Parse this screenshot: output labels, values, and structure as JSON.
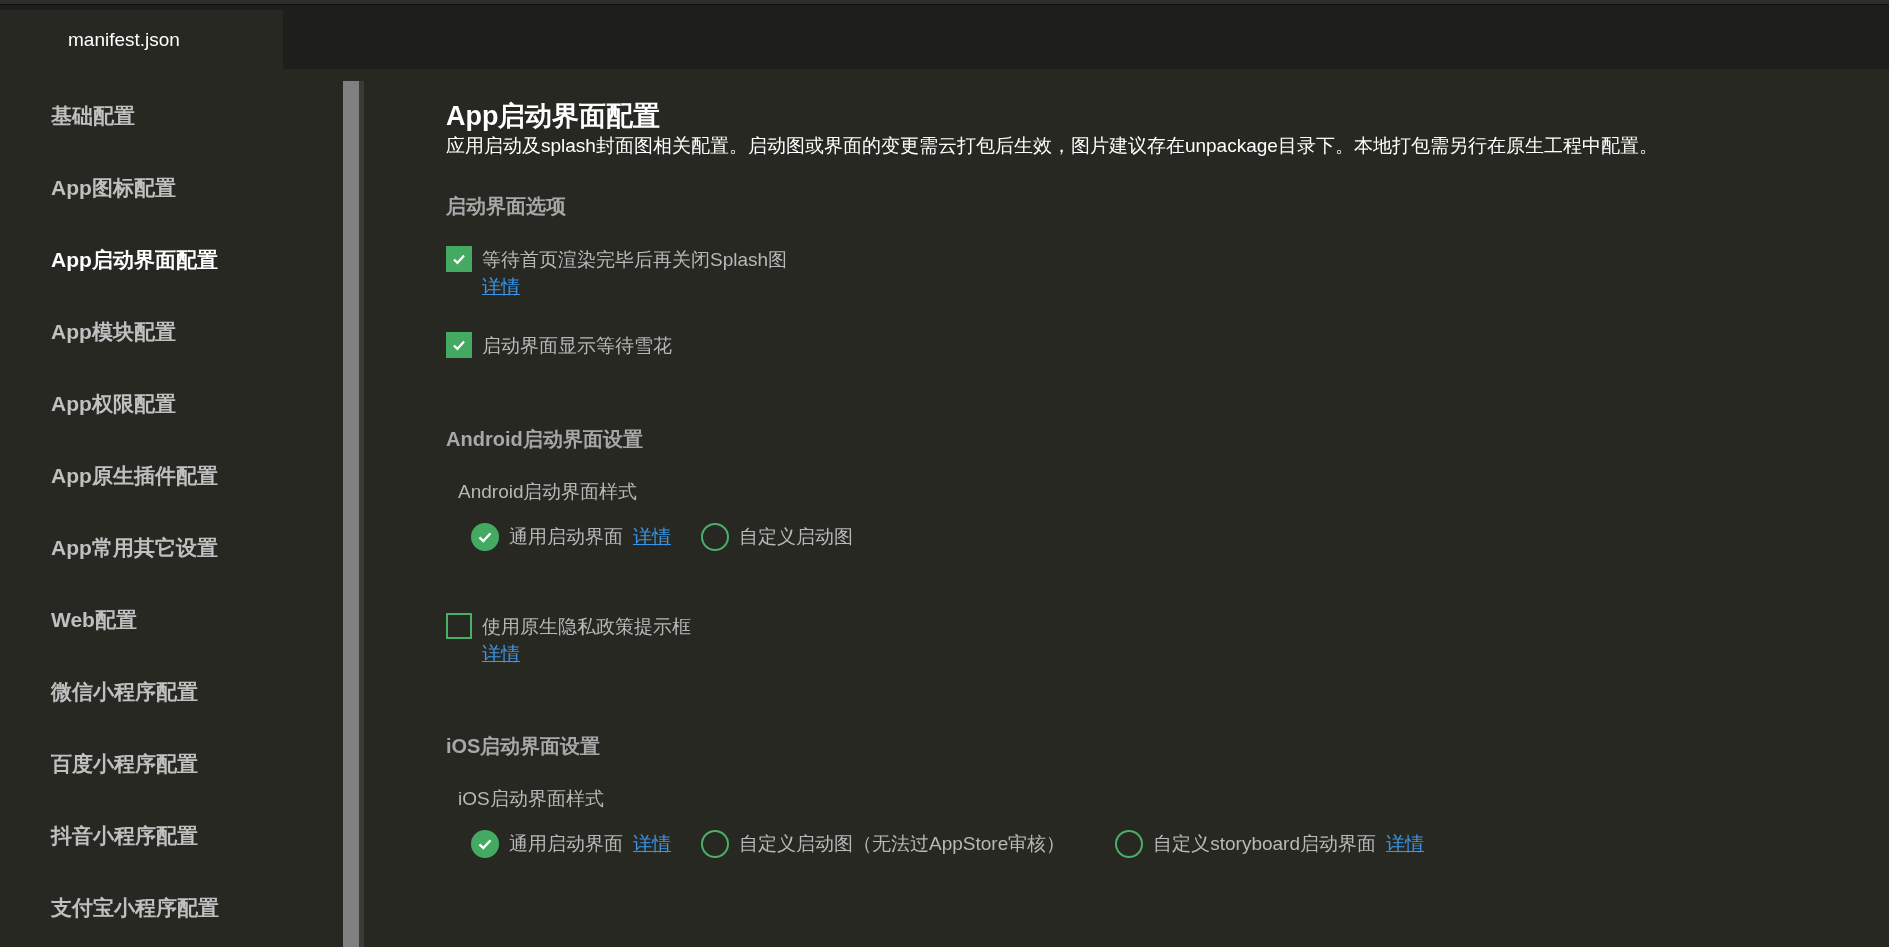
{
  "tabs": [
    {
      "label": "manifest.json",
      "selected": true
    }
  ],
  "sidebar": {
    "items": [
      {
        "label": "基础配置",
        "selected": false
      },
      {
        "label": "App图标配置",
        "selected": false
      },
      {
        "label": "App启动界面配置",
        "selected": true
      },
      {
        "label": "App模块配置",
        "selected": false
      },
      {
        "label": "App权限配置",
        "selected": false
      },
      {
        "label": "App原生插件配置",
        "selected": false
      },
      {
        "label": "App常用其它设置",
        "selected": false
      },
      {
        "label": "Web配置",
        "selected": false
      },
      {
        "label": "微信小程序配置",
        "selected": false
      },
      {
        "label": "百度小程序配置",
        "selected": false
      },
      {
        "label": "抖音小程序配置",
        "selected": false
      },
      {
        "label": "支付宝小程序配置",
        "selected": false
      }
    ]
  },
  "content": {
    "title": "App启动界面配置",
    "description": "应用启动及splash封面图相关配置。启动图或界面的变更需云打包后生效，图片建议存在unpackage目录下。本地打包需另行在原生工程中配置。",
    "sections": [
      {
        "heading": "启动界面选项",
        "items": [
          {
            "kind": "checkbox",
            "label": "等待首页渲染完毕后再关闭Splash图",
            "checked": true,
            "link": "详情"
          },
          {
            "kind": "checkbox",
            "label": "启动界面显示等待雪花",
            "checked": true
          }
        ]
      },
      {
        "heading": "Android启动界面设置",
        "items": [
          {
            "kind": "radio_group",
            "label": "Android启动界面样式",
            "options": [
              {
                "label": "通用启动界面",
                "selected": true,
                "link": "详情"
              },
              {
                "label": "自定义启动图",
                "selected": false
              }
            ]
          },
          {
            "kind": "checkbox",
            "label": "使用原生隐私政策提示框",
            "checked": false,
            "link": "详情"
          }
        ]
      },
      {
        "heading": "iOS启动界面设置",
        "items": [
          {
            "kind": "radio_group",
            "label": "iOS启动界面样式",
            "options": [
              {
                "label": "通用启动界面",
                "selected": true,
                "link": "详情"
              },
              {
                "label": "自定义启动图（无法过AppStore审核）",
                "selected": false
              },
              {
                "label": "自定义storyboard启动界面",
                "selected": false,
                "link": "详情"
              }
            ]
          }
        ]
      }
    ]
  }
}
